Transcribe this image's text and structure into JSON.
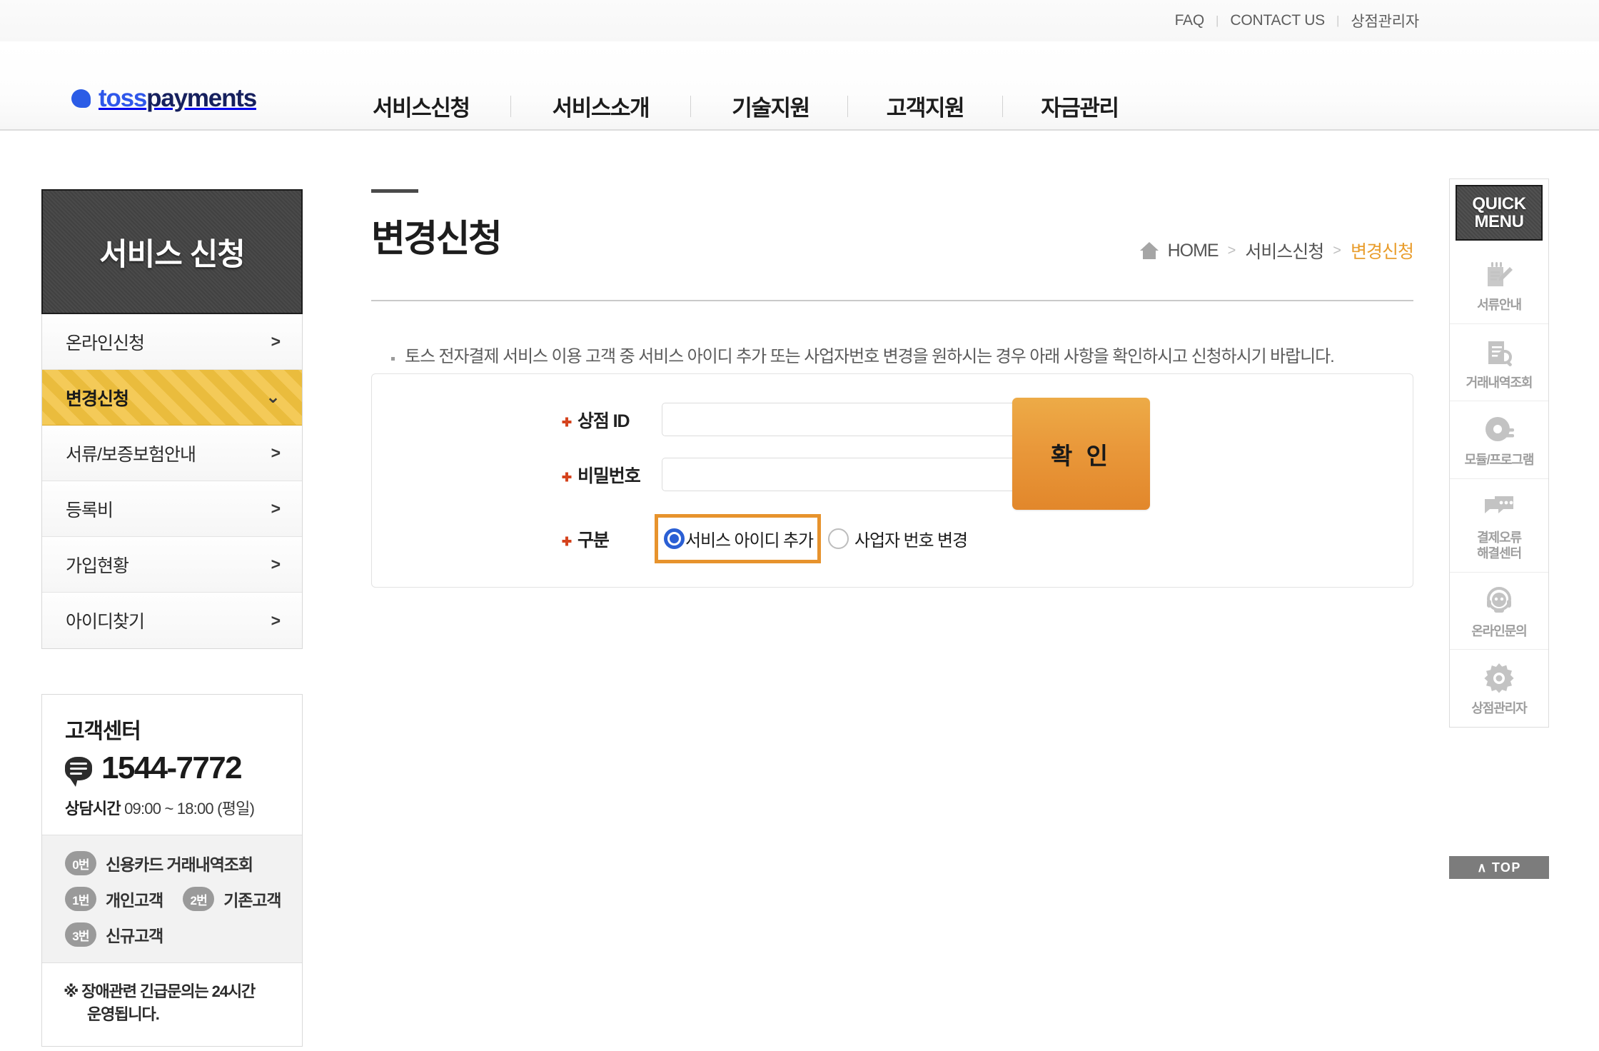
{
  "utility": {
    "links": [
      {
        "label": "FAQ"
      },
      {
        "label": "CONTACT US"
      },
      {
        "label": "상점관리자"
      }
    ],
    "separator": "|"
  },
  "brand": {
    "toss": "toss",
    "payments": "payments",
    "dot_color": "#2f57ea",
    "toss_color": "#2f57ea",
    "payments_color": "#16205e"
  },
  "mainnav": {
    "items": [
      {
        "label": "서비스신청"
      },
      {
        "label": "서비스소개"
      },
      {
        "label": "기술지원"
      },
      {
        "label": "고객지원"
      },
      {
        "label": "자금관리"
      }
    ]
  },
  "sidebar": {
    "heading": "서비스 신청",
    "active_color": "#f2c23f",
    "items": [
      {
        "label": "온라인신청",
        "chevron": ">",
        "active": false
      },
      {
        "label": "변경신청",
        "chevron": "⌄",
        "active": true
      },
      {
        "label": "서류/보증보험안내",
        "chevron": ">",
        "active": false
      },
      {
        "label": "등록비",
        "chevron": ">",
        "active": false
      },
      {
        "label": "가입현황",
        "chevron": ">",
        "active": false
      },
      {
        "label": "아이디찾기",
        "chevron": ">",
        "active": false
      }
    ]
  },
  "customer_center": {
    "title": "고객센터",
    "phone": "1544-7772",
    "hours_label": "상담시간",
    "hours_value": "09:00 ~ 18:00 (평일)",
    "menu": [
      {
        "badge": "0번",
        "label": "신용카드 거래내역조회"
      },
      {
        "badge": "1번",
        "label": "개인고객"
      },
      {
        "badge": "2번",
        "label": "기존고객"
      },
      {
        "badge": "3번",
        "label": "신규고객"
      }
    ],
    "note_line1": "※ 장애관련 긴급문의는 24시간",
    "note_line2": "운영됩니다."
  },
  "main": {
    "title": "변경신청",
    "breadcrumb": {
      "home_icon": "home-icon",
      "items": [
        {
          "label": "HOME",
          "current": false
        },
        {
          "label": "서비스신청",
          "current": false
        },
        {
          "label": "변경신청",
          "current": true
        }
      ],
      "separator": ">",
      "current_color": "#e99d2c"
    },
    "notice": "토스 전자결제 서비스 이용 고객 중 서비스 아이디 추가 또는 사업자번호 변경을 원하시는 경우 아래 사항을 확인하시고 신청하시기 바랍니다."
  },
  "form": {
    "merchant_id": {
      "label": "상점 ID",
      "required": true,
      "value": "",
      "placeholder": ""
    },
    "password": {
      "label": "비밀번호",
      "required": true,
      "value": "",
      "placeholder": ""
    },
    "type": {
      "label": "구분",
      "required": true,
      "options": [
        {
          "label": "서비스 아이디 추가",
          "selected": true,
          "highlighted": true
        },
        {
          "label": "사업자 번호 변경",
          "selected": false,
          "highlighted": false
        }
      ],
      "highlight_color": "#e7932d"
    },
    "submit_label": "확 인",
    "submit_color": "#e9983a"
  },
  "quickmenu": {
    "head_line1": "QUICK",
    "head_line2": "MENU",
    "items": [
      {
        "label": "서류안내",
        "icon": "document-pencil-icon"
      },
      {
        "label": "거래내역조회",
        "icon": "document-search-icon"
      },
      {
        "label": "모듈/프로그램",
        "icon": "disc-module-icon"
      },
      {
        "label": "결제오류\n해결센터",
        "label_line1": "결제오류",
        "label_line2": "해결센터",
        "icon": "chat-bubbles-icon"
      },
      {
        "label": "온라인문의",
        "icon": "headset-person-icon"
      },
      {
        "label": "상점관리자",
        "icon": "gear-icon"
      }
    ],
    "top_button": "TOP",
    "top_arrow": "∧"
  }
}
